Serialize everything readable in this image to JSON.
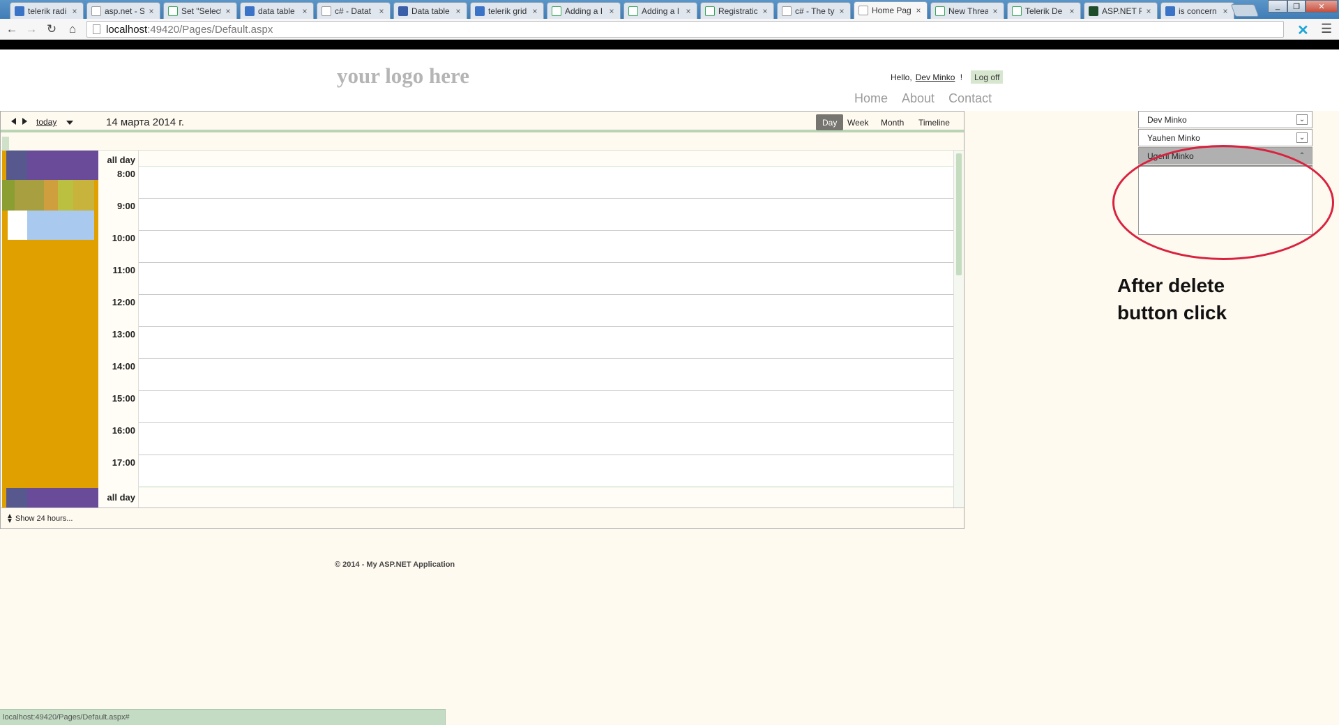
{
  "browser": {
    "tabs": [
      {
        "title": "telerik radi",
        "icon": "google-icon",
        "fav": "g"
      },
      {
        "title": "asp.net - S",
        "icon": "stackoverflow-icon",
        "fav": "doc"
      },
      {
        "title": "Set \"Select",
        "icon": "stackoverflow-icon",
        "fav": "so"
      },
      {
        "title": "data table",
        "icon": "google-icon",
        "fav": "g"
      },
      {
        "title": "c# - Datat",
        "icon": "stackoverflow-icon",
        "fav": "doc"
      },
      {
        "title": "Data table",
        "icon": "blue-icon",
        "fav": "bl"
      },
      {
        "title": "telerik grid",
        "icon": "google-icon",
        "fav": "g"
      },
      {
        "title": "Adding a I",
        "icon": "telerik-icon",
        "fav": "so"
      },
      {
        "title": "Adding a I",
        "icon": "telerik-icon",
        "fav": "so"
      },
      {
        "title": "Registratic",
        "icon": "telerik-icon",
        "fav": "so"
      },
      {
        "title": "c# - The ty",
        "icon": "stackoverflow-icon",
        "fav": "doc"
      },
      {
        "title": "Home Pag",
        "icon": "page-icon",
        "fav": "doc",
        "active": true
      },
      {
        "title": "New Threa",
        "icon": "telerik-icon",
        "fav": "so"
      },
      {
        "title": "Telerik De",
        "icon": "telerik-icon",
        "fav": "so"
      },
      {
        "title": "ASP.NET F",
        "icon": "aspnet-icon",
        "fav": "dk"
      },
      {
        "title": "is concern",
        "icon": "google-icon",
        "fav": "g"
      }
    ],
    "close_glyph": "×",
    "url_host": "localhost",
    "url_path": ":49420/Pages/Default.aspx",
    "status_url": "localhost:49420/Pages/Default.aspx#"
  },
  "header": {
    "logo": "your logo here",
    "hello": "Hello,",
    "user": "Dev Minko",
    "hello_suffix": "!",
    "logoff": "Log off",
    "nav": [
      "Home",
      "About",
      "Contact"
    ]
  },
  "scheduler": {
    "today": "today",
    "date": "14 марта 2014 г.",
    "views": [
      {
        "label": "Day",
        "active": true
      },
      {
        "label": "Week",
        "active": false
      },
      {
        "label": "Month",
        "active": false
      },
      {
        "label": "Timeline",
        "active": false
      }
    ],
    "allday": "all day",
    "hours": [
      "8:00",
      "9:00",
      "10:00",
      "11:00",
      "12:00",
      "13:00",
      "14:00",
      "15:00",
      "16:00",
      "17:00"
    ],
    "allday_bottom": "all day",
    "show24": "Show 24 hours...",
    "colors": {
      "left_column": "#e0a000",
      "grid_line": "#c9c9c9",
      "active_view": "#76756f"
    }
  },
  "resources": [
    {
      "name": "Dev Minko",
      "open": false
    },
    {
      "name": "Yauhen Minko",
      "open": false
    },
    {
      "name": "Ugeni Minko",
      "open": true
    }
  ],
  "annotation": {
    "line1": "After delete",
    "line2": "button click",
    "color": "#d9223f"
  },
  "footer": {
    "copyright": "© 2014 - My ASP.NET Application"
  }
}
